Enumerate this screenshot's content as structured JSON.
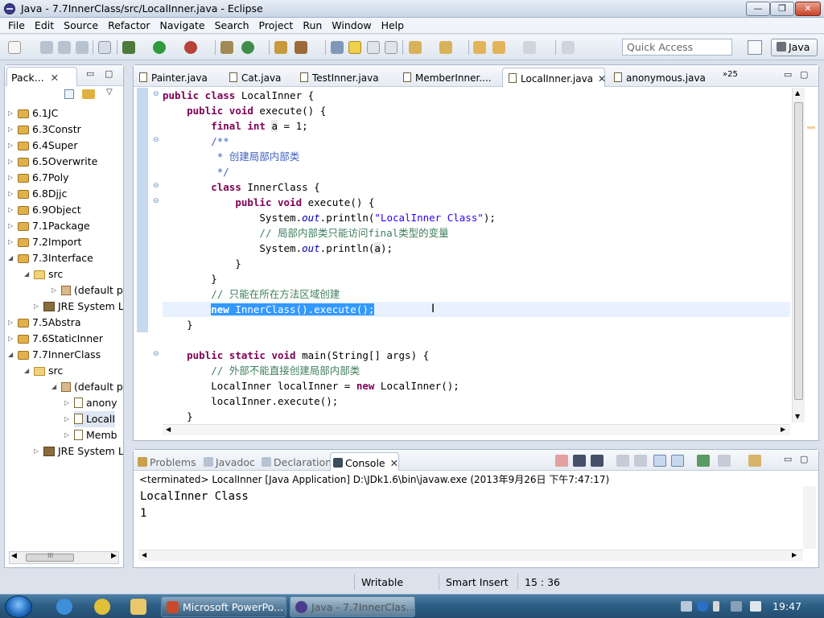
{
  "window": {
    "title": "Java - 7.7InnerClass/src/LocalInner.java - Eclipse",
    "min": "—",
    "max": "❐",
    "close": "✕"
  },
  "menu": [
    "File",
    "Edit",
    "Source",
    "Refactor",
    "Navigate",
    "Search",
    "Project",
    "Run",
    "Window",
    "Help"
  ],
  "toolbar": {
    "quick_access_placeholder": "Quick Access",
    "perspective": "Java"
  },
  "package_explorer": {
    "tab_label": "Pack...",
    "close": "✕",
    "nodes": [
      "6.1JC",
      "6.3Constr",
      "6.4Super",
      "6.5Overwrite",
      "6.7Poly",
      "6.8Djjc",
      "6.9Object",
      "7.1Package",
      "7.2Import",
      "7.3Interface",
      "src",
      "(default p",
      "JRE System L",
      "7.5Abstra",
      "7.6StaticInner",
      "7.7InnerClass",
      "src",
      "(default p",
      "anony",
      "LocalI",
      "Memb",
      "JRE System L"
    ],
    "scroll_thumb": "III"
  },
  "editor": {
    "tabs": [
      "Painter.java",
      "Cat.java",
      "TestInner.java",
      "MemberInner....",
      "LocalInner.java",
      "anonymous.java"
    ],
    "active_tab": "LocalInner.java",
    "overflow": "»25",
    "close": "✕"
  },
  "console": {
    "tabs": [
      "Problems",
      "Javadoc",
      "Declaration",
      "Console"
    ],
    "active_tab": "Console",
    "close": "✕",
    "label": "<terminated> LocalInner [Java Application] D:\\JDk1.6\\bin\\javaw.exe (2013年9月26日 下午7:47:17)",
    "output": "LocalInner Class\n1"
  },
  "status": {
    "writable": "Writable",
    "insert_mode": "Smart Insert",
    "position": "15 : 36"
  },
  "taskbar": {
    "tasks": [
      "Microsoft PowerPo...",
      "Java - 7.7InnerClas..."
    ],
    "time": "19:47"
  }
}
